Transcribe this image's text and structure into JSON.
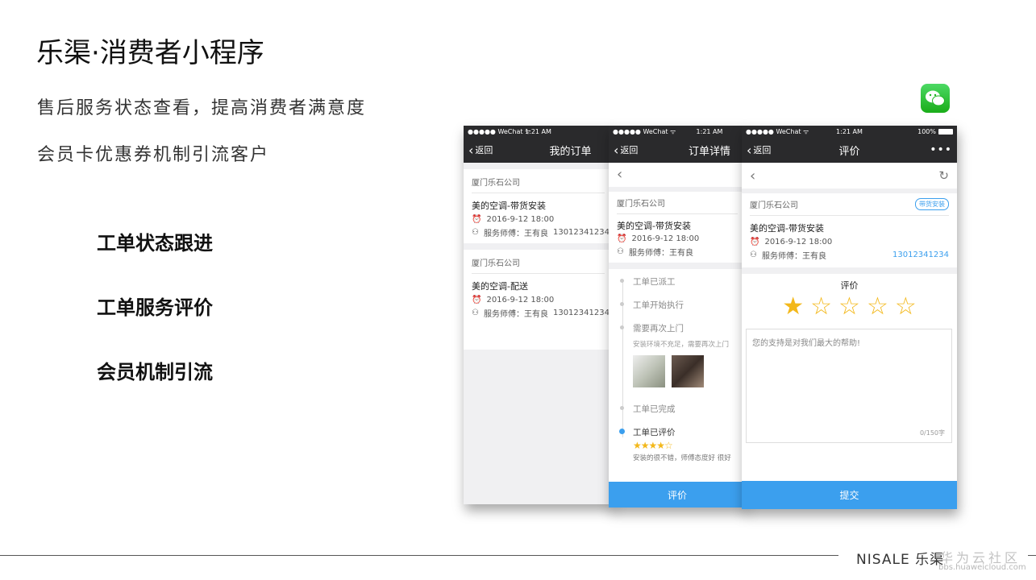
{
  "slide": {
    "title": "乐渠·消费者小程序",
    "subtitle1": "售后服务状态查看，提高消费者满意度",
    "subtitle2": "会员卡优惠券机制引流客户",
    "features": [
      "工单状态跟进",
      "工单服务评价",
      "会员机制引流"
    ],
    "footer_brand": "NISALE 乐渠",
    "footer_watermark": "华为云社区",
    "footer_url": "bbs.huaweicloud.com"
  },
  "statusbar": {
    "carrier": "●●●●● WeChat ᯤ",
    "time": "1:21 AM",
    "battery": "100%"
  },
  "phone1": {
    "back": "返回",
    "title": "我的订单",
    "orders": [
      {
        "company": "厦门乐石公司",
        "name": "美的空调-带货安装",
        "time": "2016-9-12 18:00",
        "tech": "服务师傅：王有良",
        "phone": "13012341234"
      },
      {
        "company": "厦门乐石公司",
        "name": "美的空调-配送",
        "time": "2016-9-12 18:00",
        "tech": "服务师傅：王有良",
        "phone": "13012341234"
      }
    ]
  },
  "phone2": {
    "back": "返回",
    "title": "订单详情",
    "company": "厦门乐石公司",
    "name": "美的空调-带货安装",
    "time": "2016-9-12 18:00",
    "tech": "服务师傅：王有良",
    "timeline": [
      {
        "label": "工单已派工"
      },
      {
        "label": "工单开始执行"
      },
      {
        "label": "需要再次上门",
        "note": "安装环境不充足，需要再次上门"
      },
      {
        "label": "工单已完成"
      },
      {
        "label": "工单已评价",
        "rating": 4,
        "comment": "安装的很不错，师傅态度好 很好"
      }
    ],
    "button": "评价"
  },
  "phone3": {
    "back": "返回",
    "title": "评价",
    "more": "•••",
    "company": "厦门乐石公司",
    "badge": "带货安装",
    "name": "美的空调-带货安装",
    "time": "2016-9-12 18:00",
    "tech": "服务师傅：王有良",
    "phone": "13012341234",
    "rating_label": "评价",
    "rating": 1,
    "placeholder": "您的支持是对我们最大的帮助!",
    "counter": "0/150字",
    "button": "提交"
  },
  "colors": {
    "accent": "#3b9fee",
    "star": "#f3b81b",
    "bar": "#2a2a2c"
  }
}
